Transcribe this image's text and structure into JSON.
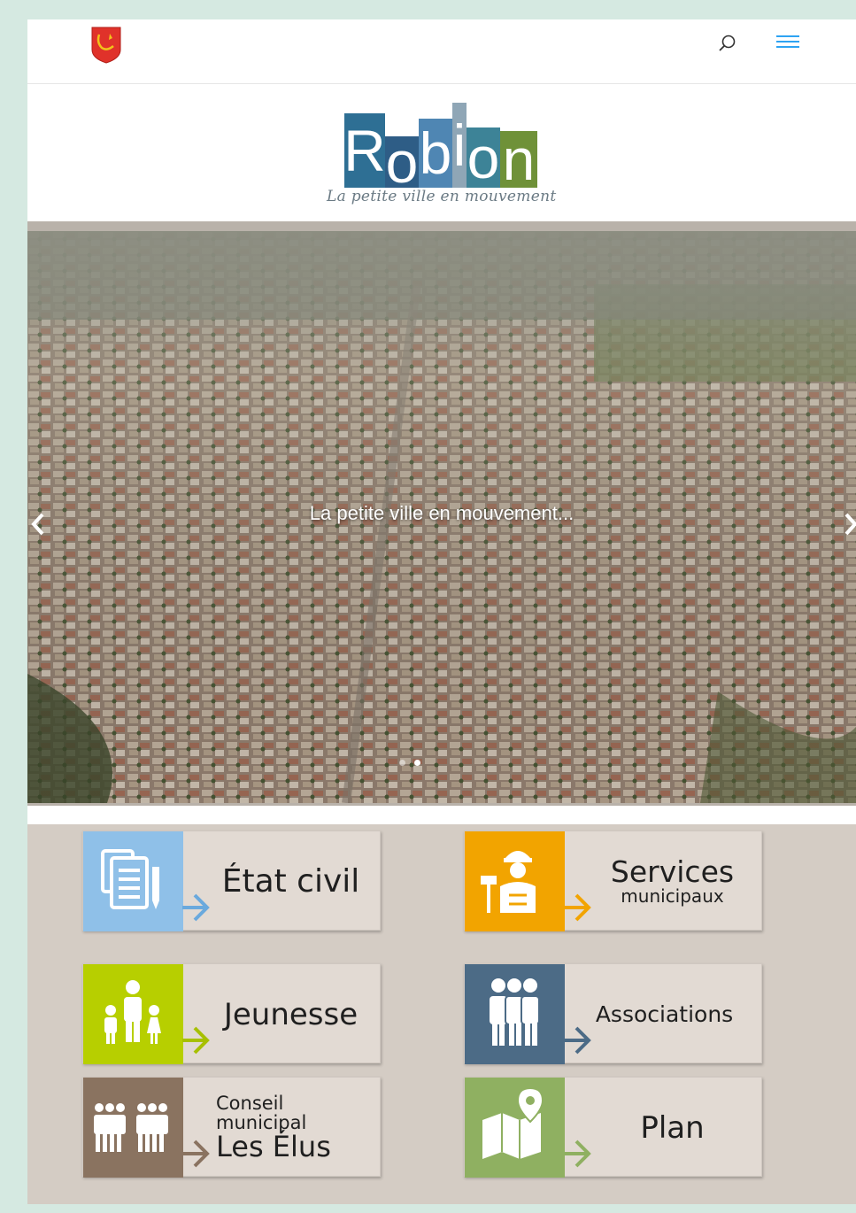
{
  "header": {
    "crest_icon": "red-shield-crest-icon",
    "search_icon": "search-icon",
    "menu_icon": "hamburger-menu-icon",
    "accent_color": "#2ea3f2"
  },
  "logo": {
    "letters": [
      "R",
      "o",
      "b",
      "i",
      "o",
      "n"
    ],
    "colors": [
      "#2e6f94",
      "#2e5d86",
      "#4f86b3",
      "#8fa6b6",
      "#3d8397",
      "#6f9138"
    ],
    "tagline": "La petite ville en mouvement"
  },
  "slider": {
    "caption": "La petite ville en mouvement...",
    "prev_icon": "chevron-left-icon",
    "next_icon": "chevron-right-icon",
    "dots": 2,
    "active_dot": 2
  },
  "tiles": [
    {
      "id": "etat-civil",
      "label": "État civil",
      "icon": "documents-icon",
      "color": "#8fc0e8",
      "arrow_color": "#6aa9dd"
    },
    {
      "id": "services",
      "label_line1": "Services",
      "label_line2": "municipaux",
      "icon": "worker-icon",
      "color": "#f2a400",
      "arrow_color": "#f2a400"
    },
    {
      "id": "jeunesse",
      "label": "Jeunesse",
      "icon": "family-icon",
      "color": "#b7cf00",
      "arrow_color": "#a7c000"
    },
    {
      "id": "associations",
      "label": "Associations",
      "icon": "group-icon",
      "color": "#4c6b86",
      "arrow_color": "#4c6b86"
    },
    {
      "id": "conseil",
      "label_line1": "Conseil",
      "label_line2": "municipal",
      "label_line3": "Les Élus",
      "icon": "council-icon",
      "color": "#8a7360",
      "arrow_color": "#8a7360"
    },
    {
      "id": "plan",
      "label": "Plan",
      "icon": "map-pin-icon",
      "color": "#8fb061",
      "arrow_color": "#8fb061"
    }
  ]
}
